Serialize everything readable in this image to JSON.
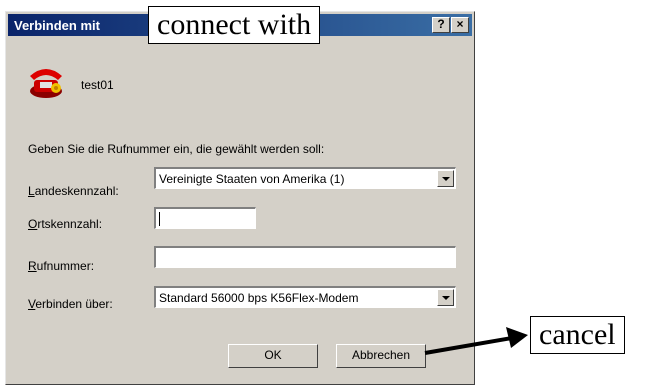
{
  "dialog": {
    "title": "Verbinden mit",
    "help_label": "?",
    "close_label": "×",
    "connection_name": "test01",
    "prompt": "Geben Sie die Rufnummer ein, die gewählt werden soll:",
    "fields": {
      "country_label_first": "L",
      "country_label_rest": "andeskennzahl:",
      "country_value": "Vereinigte Staaten von Amerika (1)",
      "area_label_first": "O",
      "area_label_rest": "rtskennzahl:",
      "area_value": "",
      "phone_label_first": "R",
      "phone_label_rest": "ufnummer:",
      "phone_value": "",
      "device_label_first": "V",
      "device_label_rest": "erbinden über:",
      "device_value": "Standard 56000 bps K56Flex-Modem"
    },
    "buttons": {
      "ok": "OK",
      "cancel": "Abbrechen"
    }
  },
  "annotations": {
    "title_callout": "connect with",
    "cancel_callout": "cancel"
  }
}
